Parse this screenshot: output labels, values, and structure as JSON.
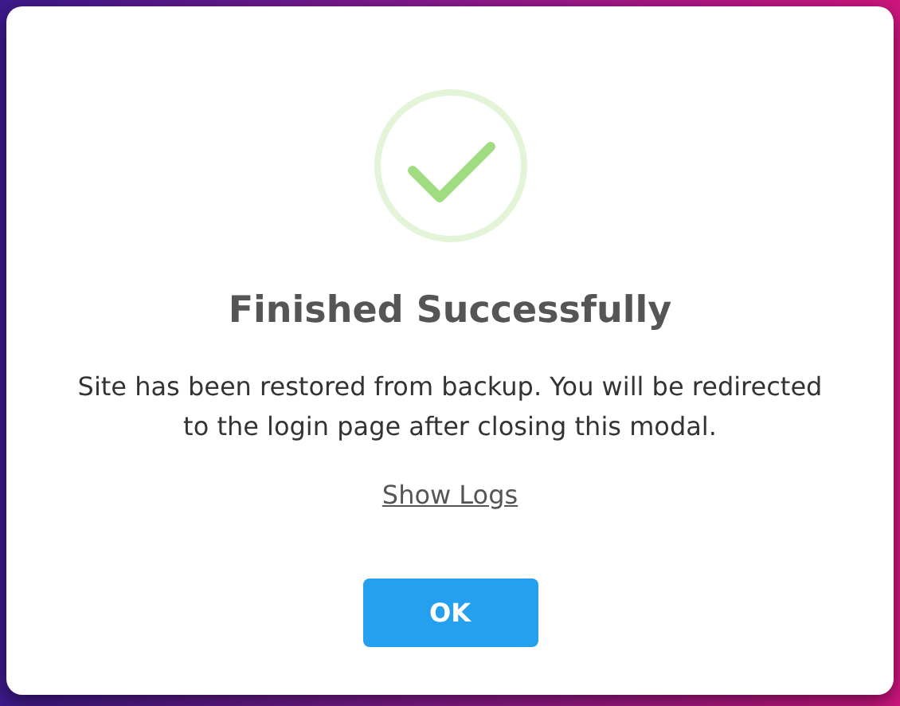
{
  "modal": {
    "title": "Finished Successfully",
    "message": "Site has been restored from backup. You will be redirected to the login page after closing this modal.",
    "link": "Show Logs",
    "buttons": [
      "OK"
    ]
  }
}
